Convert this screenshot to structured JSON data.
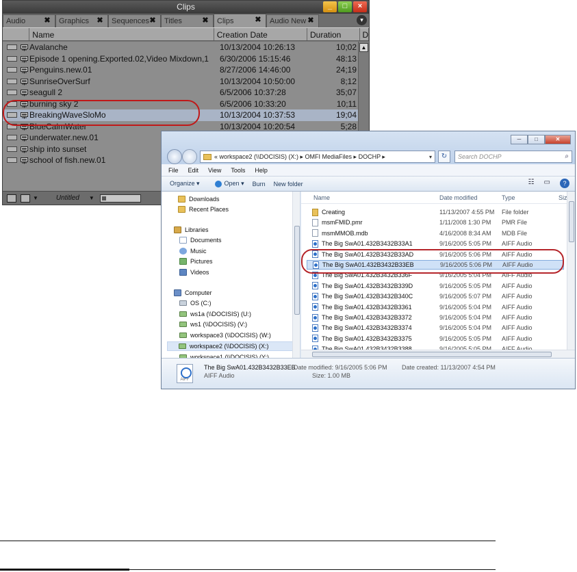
{
  "bin": {
    "title": "Clips",
    "window_buttons": {
      "minimize": "_",
      "maximize": "□",
      "close": "×"
    },
    "tabs": [
      {
        "label": "Audio",
        "active": false
      },
      {
        "label": "Graphics",
        "active": false
      },
      {
        "label": "Sequences",
        "active": false
      },
      {
        "label": "Titles",
        "active": false
      },
      {
        "label": "Clips",
        "active": true
      },
      {
        "label": "Audio New",
        "active": false
      }
    ],
    "tab_close_glyph": "✖",
    "columns": {
      "name": "Name",
      "creation_date": "Creation Date",
      "duration": "Duration",
      "overflow": "D"
    },
    "clips": [
      {
        "name": "Avalanche",
        "creation_date": "10/13/2004 10:26:13",
        "duration": "10;02"
      },
      {
        "name": "Episode 1 opening.Exported.02,Video Mixdown,1",
        "creation_date": "6/30/2006 15:15:46",
        "duration": "48:13"
      },
      {
        "name": "Penguins.new.01",
        "creation_date": "8/27/2006 14:46:00",
        "duration": "24;19"
      },
      {
        "name": "SunriseOverSurf",
        "creation_date": "10/13/2004 10:50:00",
        "duration": "8;12"
      },
      {
        "name": "seagull 2",
        "creation_date": "6/5/2006 10:37:28",
        "duration": "35;07"
      },
      {
        "name": "burning sky 2",
        "creation_date": "6/5/2006 10:33:20",
        "duration": "10;11"
      },
      {
        "name": "BreakingWaveSloMo",
        "creation_date": "10/13/2004 10:37:53",
        "duration": "19;04",
        "selected": true
      },
      {
        "name": "BlueCalmWater",
        "creation_date": "10/13/2004 10:20:54",
        "duration": "5;28"
      },
      {
        "name": "underwater.new.01",
        "creation_date": "",
        "duration": ""
      },
      {
        "name": "ship into sunset",
        "creation_date": "",
        "duration": ""
      },
      {
        "name": "school of fish.new.01",
        "creation_date": "",
        "duration": ""
      }
    ],
    "footer": {
      "view_name": "Untitled"
    }
  },
  "explorer": {
    "address_path": "« workspace2 (\\\\DOCISIS) (X:) ▸ OMFI MediaFiles ▸ DOCHP ▸",
    "search_placeholder": "Search DOCHP",
    "menu": [
      "File",
      "Edit",
      "View",
      "Tools",
      "Help"
    ],
    "toolbar": {
      "organize": "Organize ▾",
      "open": "Open ▾",
      "burn": "Burn",
      "new_folder": "New folder"
    },
    "nav": {
      "favorites": [
        "Downloads",
        "Recent Places"
      ],
      "libraries_label": "Libraries",
      "libraries": [
        "Documents",
        "Music",
        "Pictures",
        "Videos"
      ],
      "computer_label": "Computer",
      "drives": [
        "OS (C:)",
        "ws1a (\\\\DOCISIS) (U:)",
        "ws1 (\\\\DOCISIS) (V:)",
        "workspace3 (\\\\DOCISIS) (W:)",
        "workspace2 (\\\\DOCISIS) (X:)",
        "workspace1 (\\\\DOCISIS) (Y:)"
      ]
    },
    "file_columns": {
      "name": "Name",
      "date_modified": "Date modified",
      "type": "Type",
      "size": "Siz"
    },
    "files": [
      {
        "name": "Creating",
        "date": "11/13/2007 4:55 PM",
        "type": "File folder",
        "icon": "folder"
      },
      {
        "name": "msmFMID.pmr",
        "date": "1/11/2008 1:30 PM",
        "type": "PMR File",
        "icon": "plain"
      },
      {
        "name": "msmMMOB.mdb",
        "date": "4/16/2008 8:34 AM",
        "type": "MDB File",
        "icon": "plain"
      },
      {
        "name": "The Big SwA01.432B3432B33A1",
        "date": "9/16/2005 5:05 PM",
        "type": "AIFF Audio",
        "icon": "aiff"
      },
      {
        "name": "The Big SwA01.432B3432B33AD",
        "date": "9/16/2005 5:06 PM",
        "type": "AIFF Audio",
        "icon": "aiff"
      },
      {
        "name": "The Big SwA01.432B3432B33EB",
        "date": "9/16/2005 5:06 PM",
        "type": "AIFF Audio",
        "icon": "aiff",
        "selected": true
      },
      {
        "name": "The Big SwA01.432B3432B336F",
        "date": "9/16/2005 5:04 PM",
        "type": "AIFF Audio",
        "icon": "aiff"
      },
      {
        "name": "The Big SwA01.432B3432B339D",
        "date": "9/16/2005 5:05 PM",
        "type": "AIFF Audio",
        "icon": "aiff"
      },
      {
        "name": "The Big SwA01.432B3432B340C",
        "date": "9/16/2005 5:07 PM",
        "type": "AIFF Audio",
        "icon": "aiff"
      },
      {
        "name": "The Big SwA01.432B3432B3361",
        "date": "9/16/2005 5:04 PM",
        "type": "AIFF Audio",
        "icon": "aiff"
      },
      {
        "name": "The Big SwA01.432B3432B3372",
        "date": "9/16/2005 5:04 PM",
        "type": "AIFF Audio",
        "icon": "aiff"
      },
      {
        "name": "The Big SwA01.432B3432B3374",
        "date": "9/16/2005 5:04 PM",
        "type": "AIFF Audio",
        "icon": "aiff"
      },
      {
        "name": "The Big SwA01.432B3432B3375",
        "date": "9/16/2005 5:05 PM",
        "type": "AIFF Audio",
        "icon": "aiff"
      },
      {
        "name": "The Big SwA01.432B3432B3388",
        "date": "9/16/2005 5:05 PM",
        "type": "AIFF Audio",
        "icon": "aiff"
      }
    ],
    "details": {
      "name": "The Big SwA01.432B3432B33EB",
      "type": "AIFF Audio",
      "modified": "Date modified: 9/16/2005 5:06 PM",
      "size": "Size: 1.00 MB",
      "created": "Date created: 11/13/2007 4:54 PM",
      "icon_label": "AIFF"
    }
  },
  "colors": {
    "highlight": "#c01818",
    "bin_bg": "#8d8d8d",
    "explorer_frame": "#dbe6f4"
  }
}
